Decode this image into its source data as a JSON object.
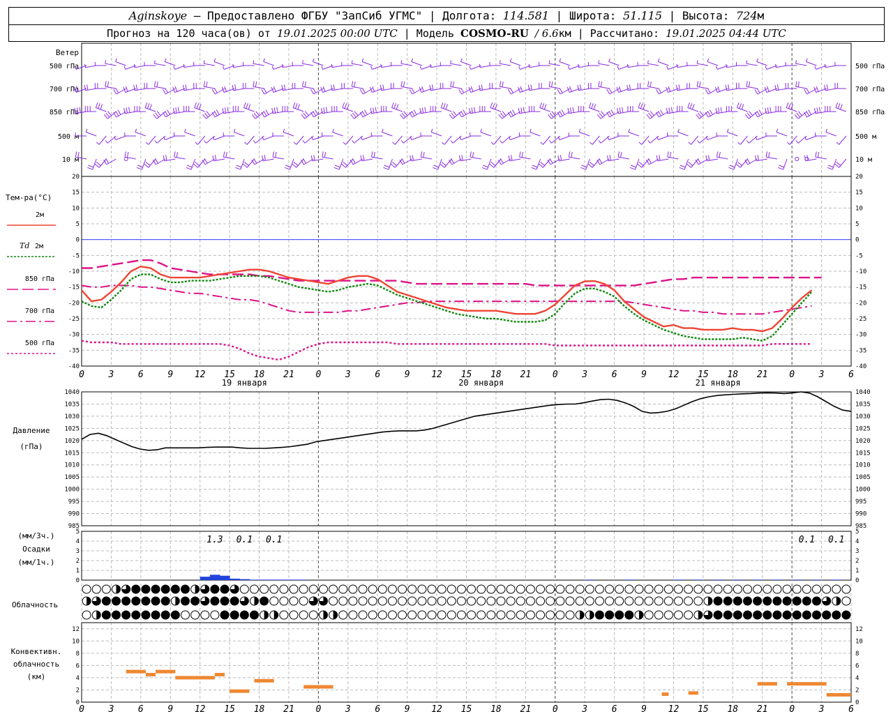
{
  "header": {
    "station": "Aginskoye",
    "provider": "– Предоставлено ФГБУ \"ЗапСиб УГМС\" |",
    "lon_label": "Долгота:",
    "lon": "114.581",
    "lat_label": "| Широта:",
    "lat": "51.115",
    "alt_label": "| Высота:",
    "alt": "724",
    "alt_unit": "м",
    "fc_prefix": "Прогноз на 120 часа(ов) от",
    "fc_start": "19.01.2025 00:00 UTC",
    "model_label": "| Модель",
    "model": "COSMO-RU",
    "model_res": "/ 6.6",
    "model_res_unit": "км",
    "calc_label": "| Рассчитано:",
    "calc_time": "19.01.2025 04:44 UTC"
  },
  "colors": {
    "wind": "#8a2be2",
    "t2m": "#ee4433",
    "td2m": "#118811",
    "t850": "#dd1188",
    "pressure": "#000000",
    "precip": "#2244dd",
    "convective": "#ee8833",
    "zero_line": "#3344ff"
  },
  "chart_data": [
    {
      "type": "barbs",
      "panel": "wind",
      "title": "Ветер",
      "levels": [
        "500 гПа",
        "700 гПа",
        "850 гПа",
        "500 м",
        "10  м"
      ]
    },
    {
      "type": "line",
      "panel": "temperature",
      "ylabel": "Тем-ра(°C)",
      "ylim": [
        -40,
        20
      ],
      "yticks": [
        20,
        15,
        10,
        5,
        0,
        -5,
        -10,
        -15,
        -20,
        -25,
        -30,
        -35,
        -40
      ],
      "x_hours": [
        0,
        1,
        2,
        3,
        4,
        5,
        6,
        7,
        8,
        9,
        10,
        11,
        12,
        13,
        14,
        15,
        16,
        17,
        18,
        19,
        20,
        21,
        22,
        23,
        24,
        25,
        26,
        27,
        28,
        29,
        30,
        31,
        32,
        33,
        34,
        35,
        36,
        37,
        38,
        39,
        40,
        41,
        42,
        43,
        44,
        45,
        46,
        47,
        48,
        49,
        50,
        51,
        52,
        53,
        54,
        55,
        56,
        57,
        58,
        59,
        60,
        61,
        62,
        63,
        64,
        65,
        66,
        67,
        68,
        69,
        70,
        71,
        72,
        73,
        74,
        75,
        76,
        77,
        78
      ],
      "series": [
        {
          "name": "2м",
          "style": "solid",
          "values": [
            -16,
            -19.5,
            -19,
            -16.5,
            -13.5,
            -10,
            -8.5,
            -9,
            -11,
            -12,
            -12,
            -12,
            -12,
            -11.5,
            -11,
            -10.5,
            -10,
            -9.5,
            -9.5,
            -10,
            -11,
            -12,
            -12.5,
            -13,
            -13.5,
            -14,
            -13,
            -12,
            -11.5,
            -11.5,
            -12.5,
            -14.5,
            -16.5,
            -17.5,
            -18.5,
            -19.5,
            -20.5,
            -21.5,
            -22,
            -22.5,
            -22.5,
            -22.5,
            -22.5,
            -23,
            -23.5,
            -23.5,
            -23.5,
            -22.5,
            -20.5,
            -17.5,
            -14.5,
            -13.2,
            -13.1,
            -14,
            -16,
            -19.5,
            -22,
            -24.5,
            -26,
            -27.5,
            -27,
            -28,
            -28,
            -28.5,
            -28.5,
            -28.5,
            -28,
            -28.5,
            -28.5,
            -29,
            -28,
            -25,
            -21.5,
            -18.5,
            -16
          ]
        },
        {
          "name": "Td  2м",
          "style": "dotted",
          "values": [
            -19.5,
            -21,
            -21.5,
            -19,
            -16,
            -12.5,
            -11,
            -11,
            -12.5,
            -13.5,
            -13.5,
            -13,
            -13,
            -13,
            -12.5,
            -12,
            -11.5,
            -11.5,
            -11.5,
            -12,
            -13,
            -14,
            -15,
            -15.5,
            -16,
            -16.5,
            -16,
            -15,
            -14.5,
            -14,
            -14.5,
            -16,
            -17.5,
            -18.5,
            -19.5,
            -20.5,
            -21.5,
            -22.5,
            -23.5,
            -24,
            -24.5,
            -25,
            -25,
            -25.5,
            -26,
            -26,
            -26,
            -25.5,
            -23.5,
            -20,
            -17,
            -15.5,
            -15.5,
            -16.5,
            -18,
            -21,
            -23.5,
            -25.5,
            -27,
            -28.5,
            -29.5,
            -30.5,
            -31,
            -31.5,
            -31.5,
            -31.5,
            -31.5,
            -31,
            -31.5,
            -32,
            -30.5,
            -27,
            -23.5,
            -20,
            -16.5
          ]
        },
        {
          "name": "850 гПа",
          "style": "dashed",
          "values": [
            -9,
            -9,
            -8.5,
            -8,
            -7.5,
            -7,
            -6.5,
            -6.5,
            -7.5,
            -9,
            -9.5,
            -10,
            -10.5,
            -11,
            -11,
            -11,
            -11,
            -11,
            -11.5,
            -11.5,
            -12,
            -12.5,
            -13,
            -13,
            -13,
            -13,
            -13,
            -13,
            -13,
            -13,
            -13,
            -13,
            -13,
            -13.5,
            -14,
            -14,
            -14,
            -14,
            -14,
            -14,
            -14,
            -14,
            -14,
            -14,
            -14,
            -14,
            -14.5,
            -14.5,
            -14.5,
            -14.5,
            -14.5,
            -14.5,
            -14.5,
            -14.5,
            -14.5,
            -14.5,
            -14.5,
            -14,
            -13.5,
            -13,
            -12.5,
            -12.5,
            -12,
            -12,
            -12,
            -12,
            -12,
            -12,
            -12,
            -12,
            -12,
            -12,
            -12,
            -12,
            -12,
            -12
          ]
        },
        {
          "name": "700 гПа",
          "style": "dashdot",
          "values": [
            -14.5,
            -15,
            -15,
            -14.5,
            -14.5,
            -14.5,
            -15,
            -15,
            -15.5,
            -16,
            -16.5,
            -17,
            -17,
            -17.5,
            -18,
            -18.5,
            -19,
            -19,
            -19.5,
            -20.5,
            -21.5,
            -22.5,
            -23,
            -23,
            -23,
            -23,
            -23,
            -22.5,
            -22.5,
            -22,
            -21.5,
            -21,
            -20.5,
            -20,
            -20,
            -19.5,
            -19.5,
            -19.5,
            -19.5,
            -19.5,
            -19.5,
            -19.5,
            -19.5,
            -19.5,
            -19.5,
            -19.5,
            -19.5,
            -19.5,
            -19.5,
            -19.5,
            -19.5,
            -19.5,
            -19.5,
            -19.5,
            -19.5,
            -19.5,
            -20,
            -20.5,
            -21,
            -21.5,
            -22,
            -22.5,
            -22.5,
            -23,
            -23,
            -23.5,
            -23.5,
            -23.5,
            -23.5,
            -23.5,
            -23,
            -22.5,
            -22,
            -21.5,
            -21
          ]
        },
        {
          "name": "500 гПа",
          "style": "dotted",
          "values": [
            -32,
            -32.5,
            -32.5,
            -32.5,
            -33,
            -33,
            -33,
            -33,
            -33,
            -33,
            -33,
            -33,
            -33,
            -33,
            -33,
            -33.5,
            -34.5,
            -36,
            -37,
            -37.5,
            -38,
            -37,
            -35.5,
            -34,
            -33,
            -32.5,
            -32.5,
            -32.5,
            -32.5,
            -32.5,
            -32.5,
            -32.5,
            -33,
            -33,
            -33,
            -33,
            -33,
            -33,
            -33,
            -33,
            -33,
            -33,
            -33,
            -33,
            -33,
            -33,
            -33,
            -33,
            -33.5,
            -33.5,
            -33.5,
            -33.5,
            -33.5,
            -33.5,
            -33.5,
            -33.5,
            -33.5,
            -33.5,
            -33.5,
            -33.5,
            -33.5,
            -33.5,
            -33.5,
            -33.5,
            -33.5,
            -33.5,
            -33.5,
            -33.5,
            -33.5,
            -33.5,
            -33,
            -33,
            -33,
            -33,
            -33
          ]
        }
      ],
      "xticks": [
        "0",
        "3",
        "6",
        "9",
        "12",
        "15",
        "18",
        "21",
        "0",
        "3",
        "6",
        "9",
        "12",
        "15",
        "18",
        "21",
        "0",
        "3",
        "6",
        "9",
        "12",
        "15",
        "18",
        "21",
        "0",
        "3",
        "6"
      ],
      "day_labels": [
        "19 января",
        "20 января",
        "21 января"
      ]
    },
    {
      "type": "line",
      "panel": "pressure",
      "ylabel": [
        "Давление",
        "(гПа)"
      ],
      "ylim": [
        985,
        1040
      ],
      "yticks": [
        1040,
        1035,
        1030,
        1025,
        1020,
        1015,
        1010,
        1005,
        1000,
        995,
        990,
        985
      ],
      "series": [
        {
          "name": "pressure",
          "values": [
            1020.5,
            1022.5,
            1023,
            1022,
            1020.5,
            1019,
            1017.5,
            1016.5,
            1016,
            1016.2,
            1017,
            1017,
            1017,
            1017,
            1017,
            1017.2,
            1017.3,
            1017.3,
            1017.3,
            1017,
            1016.8,
            1016.8,
            1016.8,
            1017,
            1017.2,
            1017.5,
            1018,
            1018.5,
            1019.5,
            1020,
            1020.5,
            1021,
            1021.5,
            1022,
            1022.5,
            1023,
            1023.5,
            1023.8,
            1024,
            1024,
            1024,
            1024.3,
            1025,
            1026,
            1027,
            1028,
            1029,
            1030,
            1030.5,
            1031,
            1031.5,
            1032,
            1032.5,
            1033,
            1033.5,
            1034,
            1034.5,
            1034.8,
            1035,
            1035,
            1035.5,
            1036.2,
            1036.8,
            1037,
            1036.5,
            1035.5,
            1034,
            1032,
            1031.3,
            1031.5,
            1032,
            1033,
            1034.5,
            1036,
            1037.2,
            1038,
            1038.5,
            1038.8,
            1039,
            1039.2,
            1039.3,
            1039.5,
            1039.6,
            1039.5,
            1039.3,
            1039.6,
            1040,
            1039.5,
            1038,
            1036,
            1034,
            1032.5,
            1032
          ]
        }
      ]
    },
    {
      "type": "bar",
      "panel": "precipitation",
      "ylabel": [
        "(мм/3ч.)",
        "Осадки",
        "(мм/1ч.)"
      ],
      "ylim": [
        0,
        5
      ],
      "yticks": [
        5,
        4,
        3,
        2,
        1,
        0
      ],
      "bars_hour": [
        12,
        13,
        14,
        15,
        16,
        17,
        18,
        19,
        20,
        21,
        22,
        51,
        55,
        60,
        62,
        64,
        66,
        68,
        70,
        72,
        74,
        76
      ],
      "bars_value": [
        0.35,
        0.55,
        0.45,
        0.15,
        0.1,
        0.05,
        0.05,
        0.05,
        0.05,
        0.05,
        0.05,
        0.05,
        0.05,
        0.05,
        0.05,
        0.05,
        0.05,
        0.05,
        0.05,
        0.05,
        0.05,
        0.05
      ],
      "labels": [
        {
          "hour": 13.5,
          "text": "1.3"
        },
        {
          "hour": 16.5,
          "text": "0.1"
        },
        {
          "hour": 19.5,
          "text": "0.1"
        },
        {
          "hour": 73.5,
          "text": "0.1"
        },
        {
          "hour": 76.5,
          "text": "0.1"
        }
      ]
    },
    {
      "type": "symbols",
      "panel": "cloudiness",
      "ylabel": "Облачность",
      "rows": [
        "000234444442344300000000000000000000000000000000000000000000000000000000000000",
        "234444444244344432400003300000000000000000000000000000000000000244444444444320",
        "024444444400004444220000220000000000000000000000002244442000002344444444444444"
      ]
    },
    {
      "type": "bar",
      "panel": "convective",
      "ylabel": [
        "Конвективн.",
        "облачность",
        "(км)"
      ],
      "ylim": [
        0,
        13
      ],
      "yticks": [
        12,
        10,
        8,
        6,
        4,
        2,
        0
      ],
      "segments": [
        {
          "from": 4.5,
          "to": 6.5,
          "value": 5
        },
        {
          "from": 6.5,
          "to": 7.5,
          "value": 4.5
        },
        {
          "from": 7.5,
          "to": 9.5,
          "value": 5
        },
        {
          "from": 9.5,
          "to": 11.5,
          "value": 4
        },
        {
          "from": 11.5,
          "to": 13.5,
          "value": 4
        },
        {
          "from": 13.5,
          "to": 14.5,
          "value": 4.5
        },
        {
          "from": 15,
          "to": 17,
          "value": 1.8
        },
        {
          "from": 17.5,
          "to": 19.5,
          "value": 3.5
        },
        {
          "from": 22.5,
          "to": 25.5,
          "value": 2.5
        },
        {
          "from": 58.8,
          "to": 59.5,
          "value": 1.3
        },
        {
          "from": 61.5,
          "to": 62.5,
          "value": 1.5
        },
        {
          "from": 68.5,
          "to": 70.5,
          "value": 3
        },
        {
          "from": 71.5,
          "to": 75.5,
          "value": 3
        },
        {
          "from": 75.5,
          "to": 78,
          "value": 1.2
        }
      ]
    }
  ]
}
